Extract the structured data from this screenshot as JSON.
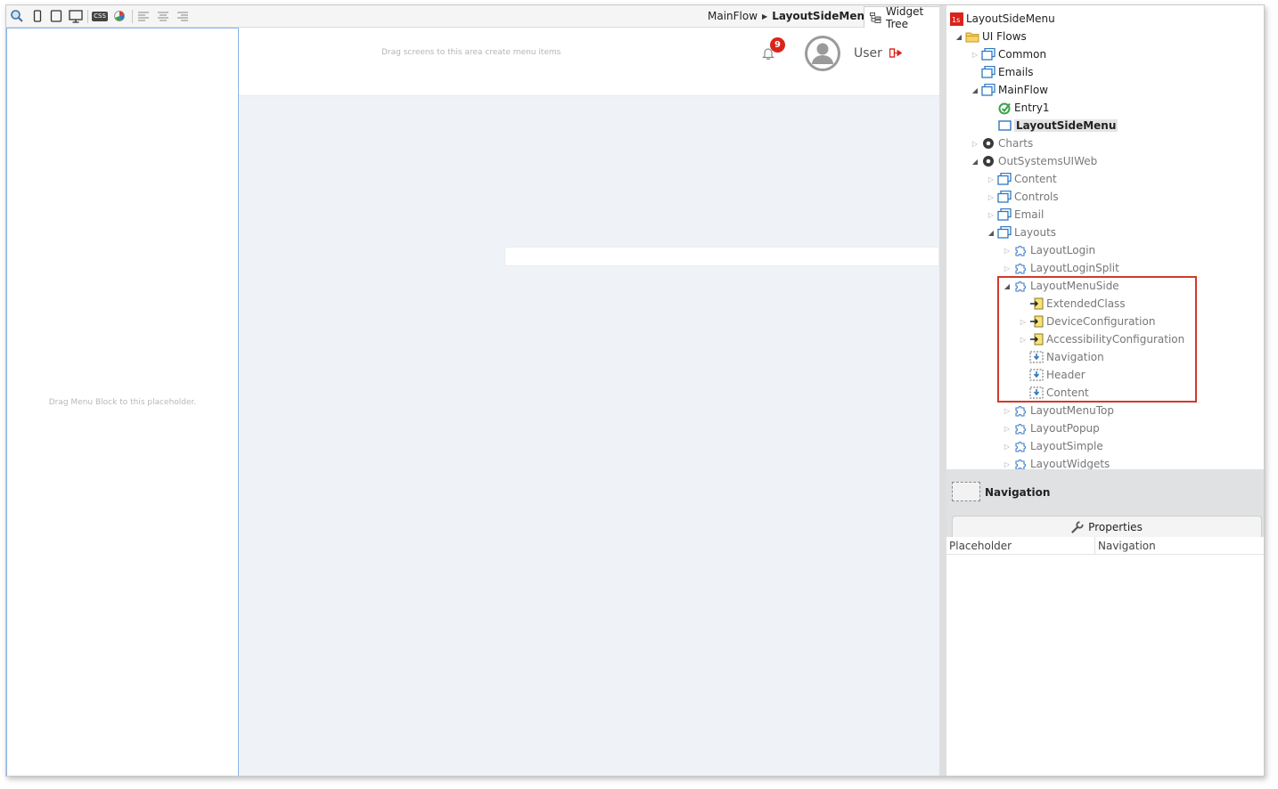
{
  "toolbar": {
    "icons": [
      "zoom-icon",
      "phone-icon",
      "tablet-icon",
      "desktop-icon",
      "css-icon",
      "theme-icon",
      "align-left-icon",
      "align-center-icon",
      "align-right-icon"
    ],
    "css_label": "CSS",
    "breadcrumb": {
      "flow": "MainFlow",
      "screen": "LayoutSideMenu"
    },
    "widget_tree_tab": "Widget Tree"
  },
  "canvas": {
    "left_placeholder_text": "Drag Menu Block  to this placeholder.",
    "header_hint": "Drag screens to this area create menu items",
    "notification_count": "9",
    "user_label": "User"
  },
  "tree": {
    "root": "LayoutSideMenu",
    "nodes": [
      {
        "label": "UI Flows"
      },
      {
        "label": "Common"
      },
      {
        "label": "Emails"
      },
      {
        "label": "MainFlow"
      },
      {
        "label": "Entry1"
      },
      {
        "label": "LayoutSideMenu"
      },
      {
        "label": "Charts"
      },
      {
        "label": "OutSystemsUIWeb"
      },
      {
        "label": "Content"
      },
      {
        "label": "Controls"
      },
      {
        "label": "Email"
      },
      {
        "label": "Layouts"
      },
      {
        "label": "LayoutLogin"
      },
      {
        "label": "LayoutLoginSplit"
      },
      {
        "label": "LayoutMenuSide"
      },
      {
        "label": "ExtendedClass"
      },
      {
        "label": "DeviceConfiguration"
      },
      {
        "label": "AccessibilityConfiguration"
      },
      {
        "label": "Navigation"
      },
      {
        "label": "Header"
      },
      {
        "label": "Content"
      },
      {
        "label": "LayoutMenuTop"
      },
      {
        "label": "LayoutPopup"
      },
      {
        "label": "LayoutSimple"
      },
      {
        "label": "LayoutWidgets"
      }
    ]
  },
  "selection": {
    "name": "Navigation"
  },
  "properties": {
    "tab_label": "Properties",
    "rows": [
      {
        "key": "Placeholder",
        "value": "Navigation"
      }
    ]
  },
  "colors": {
    "highlight": "#d03a2b",
    "badge": "#d9241c",
    "placeholder_border": "#89b4e8"
  }
}
